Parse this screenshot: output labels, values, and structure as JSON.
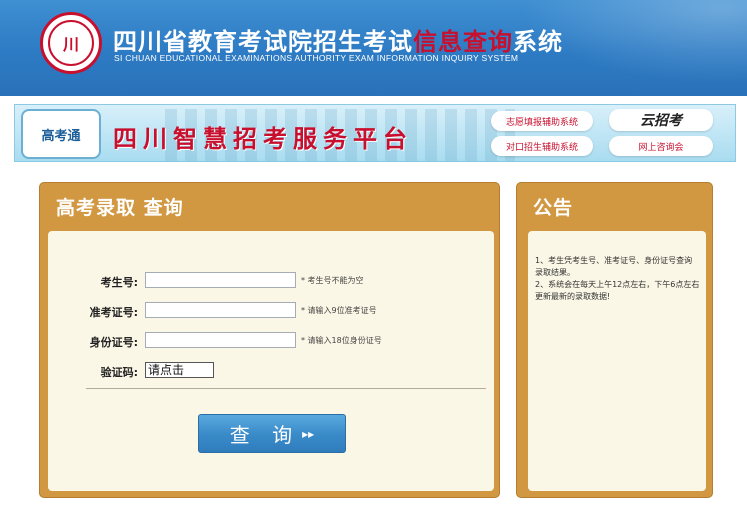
{
  "header": {
    "logo_text": "川",
    "title_prefix": "四川省教育考试院招生考试",
    "title_highlight": "信息查询",
    "title_suffix": "系统",
    "subtitle": "SI CHUAN EDUCATIONAL EXAMINATIONS AUTHORITY EXAM INFORMATION INQUIRY SYSTEM"
  },
  "banner": {
    "logo_text": "高考通",
    "title": "四川智慧招考服务平台",
    "buttons": [
      "志愿填报辅助系统",
      "对口招生辅助系统",
      "云招考",
      "网上咨询会"
    ]
  },
  "query_panel": {
    "title": "高考录取 查询",
    "fields": [
      {
        "label": "考生号:",
        "value": "",
        "hint": "* 考生号不能为空"
      },
      {
        "label": "准考证号:",
        "value": "",
        "hint": "* 请输入9位准考证号"
      },
      {
        "label": "身份证号:",
        "value": "",
        "hint": "* 请输入18位身份证号"
      }
    ],
    "captcha_label": "验证码:",
    "captcha_text": "请点击",
    "submit_label": "查 询",
    "submit_arrow": "▸▸"
  },
  "notice_panel": {
    "title": "公告",
    "items": [
      "1、考生凭考生号、准考证号、身份证号查询录取结果。",
      "2、系统会在每天上午12点左右，下午6点左右更新最新的录取数据!"
    ]
  },
  "colors": {
    "header_blue": "#2d7bc4",
    "panel_orange": "#d19741",
    "panel_body": "#fbf7e6",
    "brand_red": "#c8102e",
    "button_blue": "#3b8cca"
  }
}
